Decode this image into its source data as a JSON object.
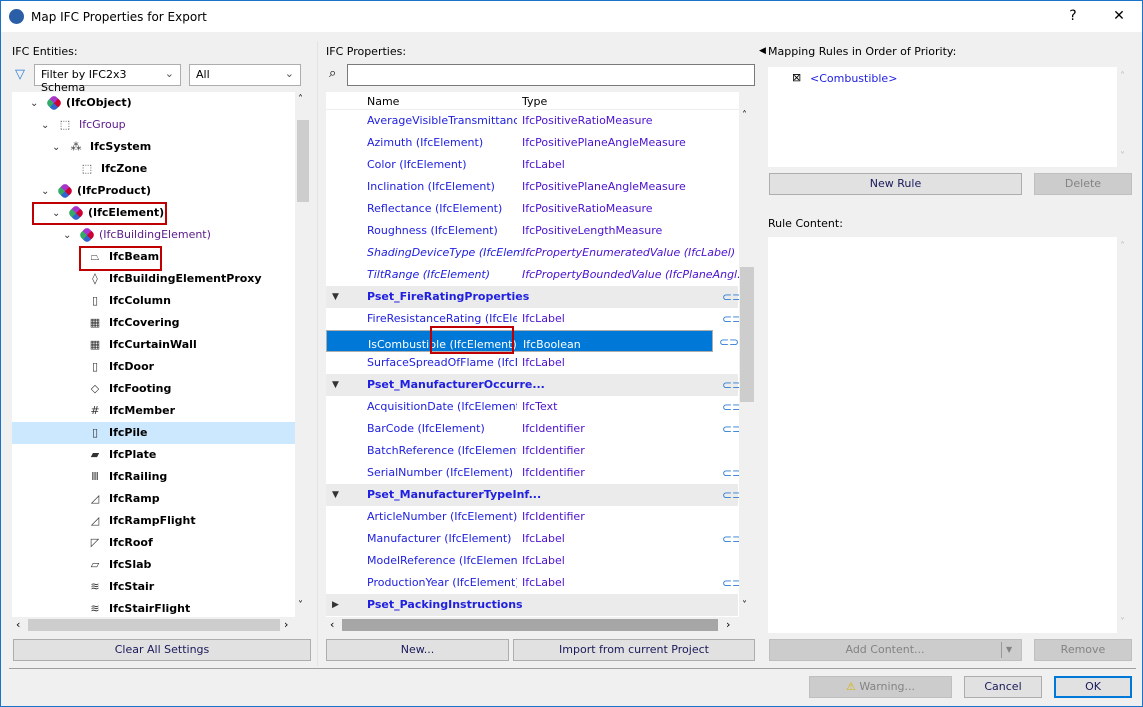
{
  "window": {
    "title": "Map IFC Properties for Export",
    "help": "?",
    "close": "✕"
  },
  "left": {
    "label": "IFC Entities:",
    "filter": "Filter by IFC2x3 Schema",
    "filter2": "All",
    "tree": [
      {
        "label": "(IfcObject)",
        "level": 0,
        "exp": "v",
        "bold": true,
        "icon": "ifc"
      },
      {
        "label": "IfcGroup",
        "level": 1,
        "exp": "v",
        "bold": false,
        "icon": "group"
      },
      {
        "label": "IfcSystem",
        "level": 2,
        "exp": "v",
        "bold": true,
        "icon": "system"
      },
      {
        "label": "IfcZone",
        "level": 3,
        "exp": "",
        "bold": true,
        "icon": "zone"
      },
      {
        "label": "(IfcProduct)",
        "level": 1,
        "exp": "v",
        "bold": true,
        "icon": "ifc"
      },
      {
        "label": "(IfcElement)",
        "level": 2,
        "exp": "v",
        "bold": true,
        "icon": "ifc"
      },
      {
        "label": "(IfcBuildingElement)",
        "level": 3,
        "exp": "v",
        "bold": false,
        "icon": "ifc"
      },
      {
        "label": "IfcBeam",
        "level": 4,
        "bold": true,
        "icon": "beam"
      },
      {
        "label": "IfcBuildingElementProxy",
        "level": 4,
        "bold": true,
        "icon": "proxy"
      },
      {
        "label": "IfcColumn",
        "level": 4,
        "bold": true,
        "icon": "column"
      },
      {
        "label": "IfcCovering",
        "level": 4,
        "bold": true,
        "icon": "covering"
      },
      {
        "label": "IfcCurtainWall",
        "level": 4,
        "bold": true,
        "icon": "curtainwall"
      },
      {
        "label": "IfcDoor",
        "level": 4,
        "bold": true,
        "icon": "door"
      },
      {
        "label": "IfcFooting",
        "level": 4,
        "bold": true,
        "icon": "footing"
      },
      {
        "label": "IfcMember",
        "level": 4,
        "bold": true,
        "icon": "member"
      },
      {
        "label": "IfcPile",
        "level": 4,
        "bold": true,
        "icon": "pile"
      },
      {
        "label": "IfcPlate",
        "level": 4,
        "bold": true,
        "icon": "plate"
      },
      {
        "label": "IfcRailing",
        "level": 4,
        "bold": true,
        "icon": "railing"
      },
      {
        "label": "IfcRamp",
        "level": 4,
        "bold": true,
        "icon": "ramp"
      },
      {
        "label": "IfcRampFlight",
        "level": 4,
        "bold": true,
        "icon": "rampflight"
      },
      {
        "label": "IfcRoof",
        "level": 4,
        "bold": true,
        "icon": "roof"
      },
      {
        "label": "IfcSlab",
        "level": 4,
        "bold": true,
        "icon": "slab"
      },
      {
        "label": "IfcStair",
        "level": 4,
        "bold": true,
        "icon": "stair"
      },
      {
        "label": "IfcStairFlight",
        "level": 4,
        "bold": true,
        "icon": "stairflight"
      }
    ],
    "clear_button": "Clear All Settings"
  },
  "center": {
    "label": "IFC Properties:",
    "search_value": "",
    "col_name": "Name",
    "col_type": "Type",
    "rows": [
      {
        "kind": "item",
        "name": "AverageVisibleTransmittanc...",
        "type": "IfcPositiveRatioMeasure"
      },
      {
        "kind": "item",
        "name": "Azimuth (IfcElement)",
        "type": "IfcPositivePlaneAngleMeasure"
      },
      {
        "kind": "item",
        "name": "Color (IfcElement)",
        "type": "IfcLabel"
      },
      {
        "kind": "item",
        "name": "Inclination (IfcElement)",
        "type": "IfcPositivePlaneAngleMeasure"
      },
      {
        "kind": "item",
        "name": "Reflectance (IfcElement)",
        "type": "IfcPositiveRatioMeasure"
      },
      {
        "kind": "item",
        "name": "Roughness (IfcElement)",
        "type": "IfcPositiveLengthMeasure"
      },
      {
        "kind": "italic",
        "name": "ShadingDeviceType (IfcElement)",
        "type": "IfcPropertyEnumeratedValue (IfcLabel)"
      },
      {
        "kind": "italic",
        "name": "TiltRange (IfcElement)",
        "type": "IfcPropertyBoundedValue (IfcPlaneAngl..."
      },
      {
        "kind": "header",
        "name": "Pset_FireRatingProperties",
        "open": true,
        "link": true
      },
      {
        "kind": "item",
        "name": "FireResistanceRating (IfcEle...",
        "type": "IfcLabel",
        "link": true
      },
      {
        "kind": "selected",
        "name": "IsCombustible (IfcElement)",
        "type": "IfcBoolean",
        "link": true
      },
      {
        "kind": "item",
        "name": "SurfaceSpreadOfFlame (IfcE...",
        "type": "IfcLabel"
      },
      {
        "kind": "header",
        "name": "Pset_ManufacturerOccurre...",
        "open": true,
        "link": true
      },
      {
        "kind": "item",
        "name": "AcquisitionDate (IfcElement)",
        "type": "IfcText",
        "link": true
      },
      {
        "kind": "item",
        "name": "BarCode (IfcElement)",
        "type": "IfcIdentifier",
        "link": true
      },
      {
        "kind": "item",
        "name": "BatchReference (IfcElement)",
        "type": "IfcIdentifier"
      },
      {
        "kind": "item",
        "name": "SerialNumber (IfcElement)",
        "type": "IfcIdentifier",
        "link": true
      },
      {
        "kind": "header",
        "name": "Pset_ManufacturerTypeInf...",
        "open": true,
        "link": true
      },
      {
        "kind": "item",
        "name": "ArticleNumber (IfcElement)",
        "type": "IfcIdentifier"
      },
      {
        "kind": "item",
        "name": "Manufacturer (IfcElement)",
        "type": "IfcLabel",
        "link": true
      },
      {
        "kind": "item",
        "name": "ModelReference (IfcElement)",
        "type": "IfcLabel"
      },
      {
        "kind": "item",
        "name": "ProductionYear (IfcElement)",
        "type": "IfcLabel",
        "link": true
      },
      {
        "kind": "header",
        "name": "Pset_PackingInstructions",
        "open": false
      }
    ],
    "new_button": "New...",
    "import_button": "Import from current Project"
  },
  "right": {
    "rules_label": "Mapping Rules in Order of Priority:",
    "rule": "<Combustible>",
    "new_rule": "New Rule",
    "delete": "Delete",
    "content_label": "Rule Content:",
    "add_content": "Add Content...",
    "remove": "Remove"
  },
  "footer": {
    "warning": "Warning...",
    "cancel": "Cancel",
    "ok": "OK"
  }
}
